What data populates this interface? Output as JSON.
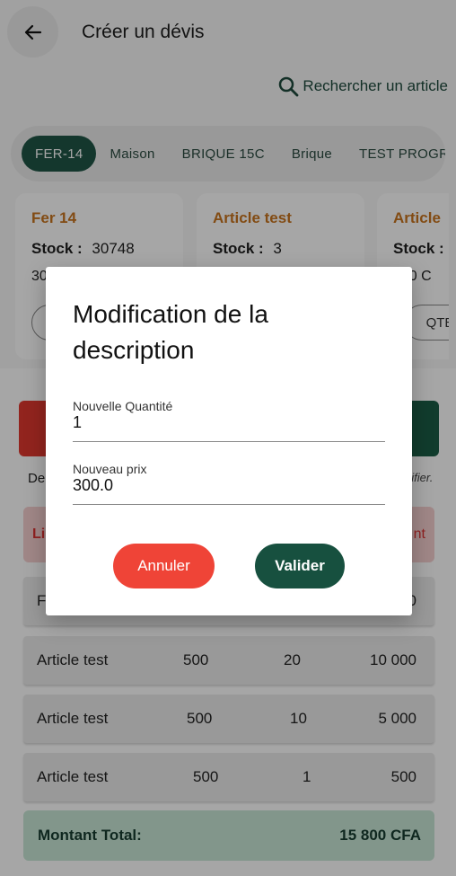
{
  "header": {
    "title": "Créer un dévis",
    "search_label": "Rechercher un article"
  },
  "categories": [
    "FER-14",
    "Maison",
    "BRIQUE 15C",
    "Brique",
    "TEST PROGR"
  ],
  "cards": [
    {
      "name": "Fer 14",
      "stock_label": "Stock :",
      "stock_value": "30748",
      "price": "30",
      "qty_label": ""
    },
    {
      "name": "Article test",
      "stock_label": "Stock :",
      "stock_value": "3",
      "price": "",
      "qty_label": ""
    },
    {
      "name": "Article",
      "stock_label": "Stock :",
      "stock_value": "",
      "price": "000 C",
      "qty_label": "QTE"
    }
  ],
  "hints": {
    "left": "De",
    "right": "difier."
  },
  "alert": {
    "left": "Li",
    "right": "nt"
  },
  "rows": [
    {
      "name": "F",
      "price": "",
      "qty": "",
      "total": "0"
    },
    {
      "name": "Article test",
      "price": "500",
      "qty": "20",
      "total": "10 000"
    },
    {
      "name": "Article test",
      "price": "500",
      "qty": "10",
      "total": "5 000"
    },
    {
      "name": "Article test",
      "price": "500",
      "qty": "1",
      "total": "500"
    }
  ],
  "total": {
    "label": "Montant Total:",
    "value": "15 800 CFA"
  },
  "dialog": {
    "title": "Modification de la description",
    "quantity_label": "Nouvelle Quantité",
    "quantity_value": "1",
    "price_label": "Nouveau prix",
    "price_value": "300.0",
    "cancel_label": "Annuler",
    "confirm_label": "Valider"
  },
  "colors": {
    "accent_green": "#17503f",
    "danger_red": "#ef4437",
    "card_title": "#c8741e"
  }
}
